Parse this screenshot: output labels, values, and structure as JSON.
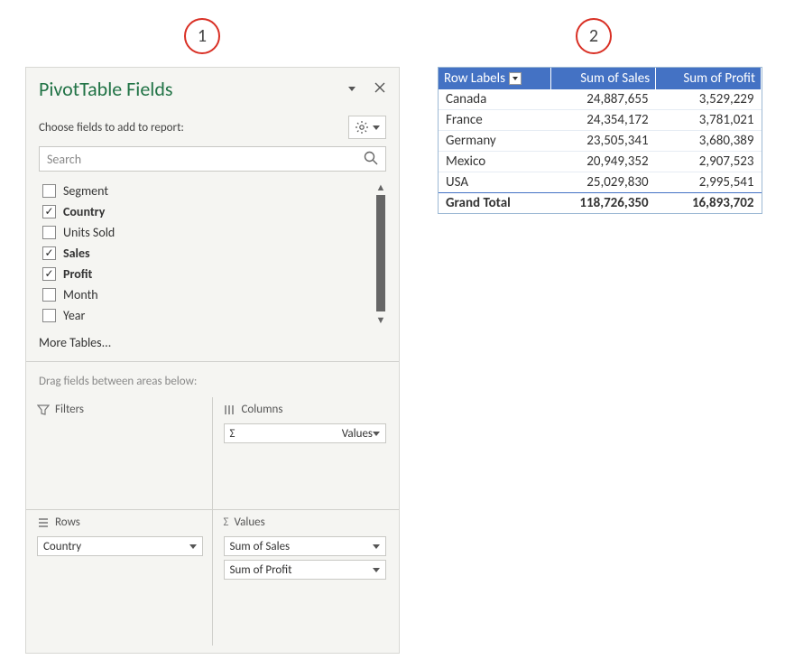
{
  "callouts": {
    "c1": "1",
    "c2": "2"
  },
  "panel": {
    "title": "PivotTable Fields",
    "subheader": "Choose fields to add to report:",
    "search_placeholder": "Search",
    "fields": [
      {
        "label": "Segment",
        "checked": false,
        "bold": false
      },
      {
        "label": "Country",
        "checked": true,
        "bold": true
      },
      {
        "label": "Units Sold",
        "checked": false,
        "bold": false
      },
      {
        "label": " Sales",
        "checked": true,
        "bold": true
      },
      {
        "label": "Profit",
        "checked": true,
        "bold": true
      },
      {
        "label": "Month",
        "checked": false,
        "bold": false
      },
      {
        "label": "Year",
        "checked": false,
        "bold": false
      }
    ],
    "more_tables": "More Tables...",
    "drag_label": "Drag fields between areas below:",
    "areas": {
      "filters": {
        "title": "Filters",
        "items": []
      },
      "columns": {
        "title": "Columns",
        "items": [
          "Values"
        ],
        "sigma": true
      },
      "rows": {
        "title": "Rows",
        "items": [
          "Country"
        ]
      },
      "values": {
        "title": "Values",
        "items": [
          "Sum of  Sales",
          "Sum of Profit"
        ]
      }
    }
  },
  "pivot": {
    "headers": [
      "Row Labels",
      "Sum of  Sales",
      "Sum of Profit"
    ],
    "rows": [
      {
        "label": "Canada",
        "sales": "24,887,655",
        "profit": "3,529,229"
      },
      {
        "label": "France",
        "sales": "24,354,172",
        "profit": "3,781,021"
      },
      {
        "label": "Germany",
        "sales": "23,505,341",
        "profit": "3,680,389"
      },
      {
        "label": "Mexico",
        "sales": "20,949,352",
        "profit": "2,907,523"
      },
      {
        "label": "USA",
        "sales": "25,029,830",
        "profit": "2,995,541"
      }
    ],
    "grand_total": {
      "label": "Grand Total",
      "sales": "118,726,350",
      "profit": "16,893,702"
    }
  }
}
